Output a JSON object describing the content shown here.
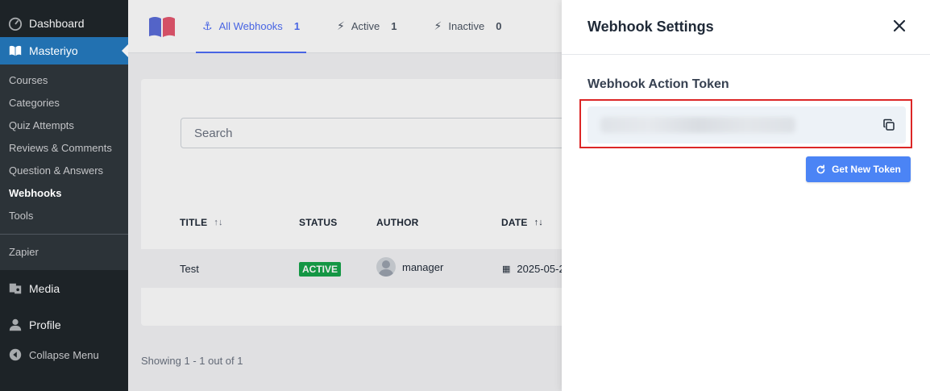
{
  "sidebar": {
    "dashboard": "Dashboard",
    "masteriyo": "Masteriyo",
    "submenu": [
      "Courses",
      "Categories",
      "Quiz Attempts",
      "Reviews & Comments",
      "Question & Answers",
      "Webhooks",
      "Tools"
    ],
    "zapier": "Zapier",
    "media": "Media",
    "profile": "Profile",
    "collapse": "Collapse Menu"
  },
  "tabs": [
    {
      "label": "All Webhooks",
      "count": "1"
    },
    {
      "label": "Active",
      "count": "1"
    },
    {
      "label": "Inactive",
      "count": "0"
    }
  ],
  "search": {
    "placeholder": "Search"
  },
  "table": {
    "headers": [
      "TITLE",
      "STATUS",
      "AUTHOR",
      "DATE"
    ],
    "rows": [
      {
        "title": "Test",
        "status": "ACTIVE",
        "author": "manager",
        "date": "2025-05-2"
      }
    ]
  },
  "footer": {
    "showing": "Showing 1 - 1 out of 1"
  },
  "drawer": {
    "title": "Webhook Settings",
    "token_label": "Webhook Action Token",
    "get_new_token": "Get New Token"
  },
  "colors": {
    "accent": "#4f6ef7",
    "highlight": "#dc2626",
    "wp_blue": "#2271b1",
    "status_active": "#16a34a"
  }
}
